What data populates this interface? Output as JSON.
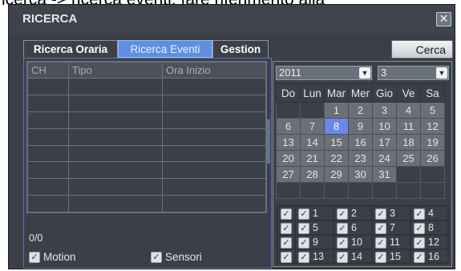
{
  "caption_text": "icerca -> ricerca eventi, fare riferimento alla",
  "window": {
    "title": "RICERCA",
    "close_label": "✕"
  },
  "tabs": [
    {
      "label": "Ricerca Oraria",
      "active": false
    },
    {
      "label": "Ricerca Eventi",
      "active": true
    },
    {
      "label": "Gestion",
      "active": false
    }
  ],
  "search_button": "Cerca",
  "results": {
    "columns": [
      "CH",
      "Tipo",
      "Ora Inizio"
    ],
    "empty_rows": 8,
    "counter": "0/0"
  },
  "filters": [
    {
      "label": "Motion",
      "checked": true
    },
    {
      "label": "Sensori",
      "checked": true
    }
  ],
  "calendar": {
    "year": "2011",
    "month": "3",
    "weekdays": [
      "Do",
      "Lun",
      "Mar",
      "Mer",
      "Gio",
      "Ve",
      "Sa"
    ],
    "weeks": [
      [
        "",
        "",
        "1",
        "2",
        "3",
        "4",
        "5"
      ],
      [
        "6",
        "7",
        "8",
        "9",
        "10",
        "11",
        "12"
      ],
      [
        "13",
        "14",
        "15",
        "16",
        "17",
        "18",
        "19"
      ],
      [
        "20",
        "21",
        "22",
        "23",
        "24",
        "25",
        "26"
      ],
      [
        "27",
        "28",
        "29",
        "30",
        "31",
        "",
        ""
      ],
      [
        "",
        "",
        "",
        "",
        "",
        "",
        ""
      ]
    ],
    "selected_day": "8"
  },
  "channels": {
    "all_checked": true,
    "list": [
      "1",
      "2",
      "3",
      "4",
      "5",
      "6",
      "7",
      "8",
      "9",
      "10",
      "11",
      "12",
      "13",
      "14",
      "15",
      "16"
    ]
  },
  "colors": {
    "window_bg": "#3b4048",
    "active_tab": "#5e8fe0",
    "selected_day": "#6f86e6",
    "panel_border": "#5874b8"
  }
}
